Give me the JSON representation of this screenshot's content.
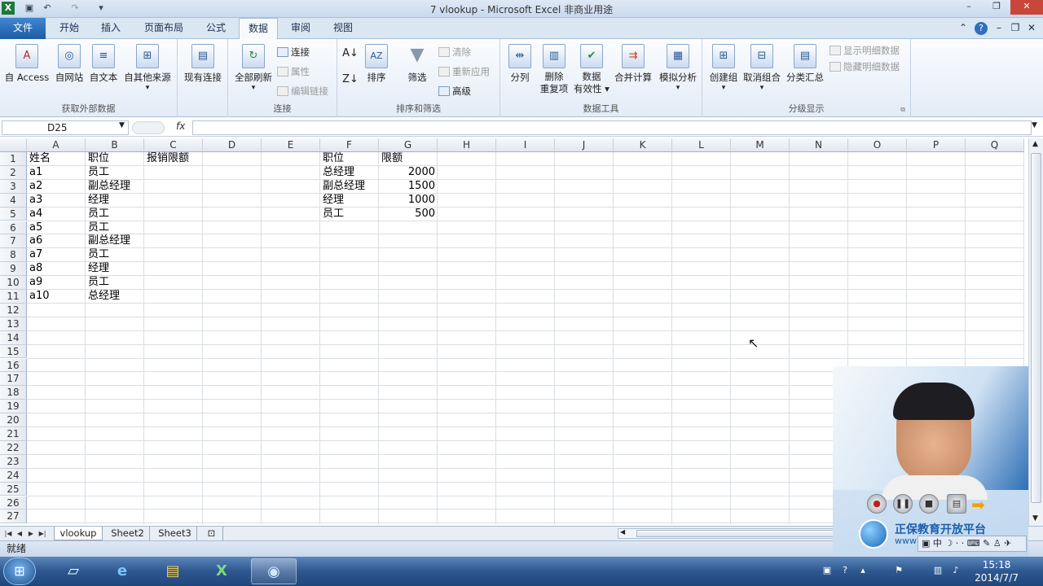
{
  "window": {
    "title": "7 vlookup - Microsoft Excel 非商业用途"
  },
  "tabs": [
    "文件",
    "开始",
    "插入",
    "页面布局",
    "公式",
    "数据",
    "审阅",
    "视图"
  ],
  "ribbon": {
    "get_external": {
      "label": "获取外部数据",
      "buttons": [
        "自 Access",
        "自网站",
        "自文本",
        "自其他来源"
      ]
    },
    "existing_conn": "现有连接",
    "connections": {
      "label": "连接",
      "refresh_all": "全部刷新",
      "small": [
        "连接",
        "属性",
        "编辑链接"
      ]
    },
    "sort_filter": {
      "label": "排序和筛选",
      "sort": "排序",
      "filter": "筛选",
      "small": [
        "清除",
        "重新应用",
        "高级"
      ]
    },
    "data_tools": {
      "label": "数据工具",
      "buttons": [
        "分列",
        "删除\n重复项",
        "数据\n有效性 ▾",
        "合并计算",
        "模拟分析"
      ]
    },
    "outline": {
      "label": "分级显示",
      "buttons": [
        "创建组",
        "取消组合",
        "分类汇总"
      ],
      "small": [
        "显示明细数据",
        "隐藏明细数据"
      ]
    }
  },
  "formula_bar": {
    "name_box": "D25",
    "fx": "fx",
    "content": ""
  },
  "columns": [
    "A",
    "B",
    "C",
    "D",
    "E",
    "F",
    "G",
    "H",
    "I",
    "J",
    "K",
    "L",
    "M",
    "N",
    "O",
    "P",
    "Q"
  ],
  "rows": [
    "1",
    "2",
    "3",
    "4",
    "5",
    "6",
    "7",
    "8",
    "9",
    "10",
    "11",
    "12",
    "13",
    "14",
    "15",
    "16",
    "17",
    "18",
    "19",
    "20",
    "21",
    "22",
    "23",
    "24",
    "25",
    "26",
    "27"
  ],
  "sheet": {
    "A": [
      "姓名",
      "a1",
      "a2",
      "a3",
      "a4",
      "a5",
      "a6",
      "a7",
      "a8",
      "a9",
      "a10"
    ],
    "B": [
      "职位",
      "员工",
      "副总经理",
      "经理",
      "员工",
      "员工",
      "副总经理",
      "员工",
      "经理",
      "员工",
      "总经理"
    ],
    "C1": "报销限额",
    "F": [
      "职位",
      "总经理",
      "副总经理",
      "经理",
      "员工"
    ],
    "G": [
      "限额",
      "2000",
      "1500",
      "1000",
      "500"
    ]
  },
  "sheet_tabs": [
    "vlookup",
    "Sheet2",
    "Sheet3"
  ],
  "status": "就绪",
  "video": {
    "brand": "正保教育开放平台",
    "www": "www"
  },
  "clock": {
    "time": "15:18",
    "date": "2014/7/7"
  }
}
